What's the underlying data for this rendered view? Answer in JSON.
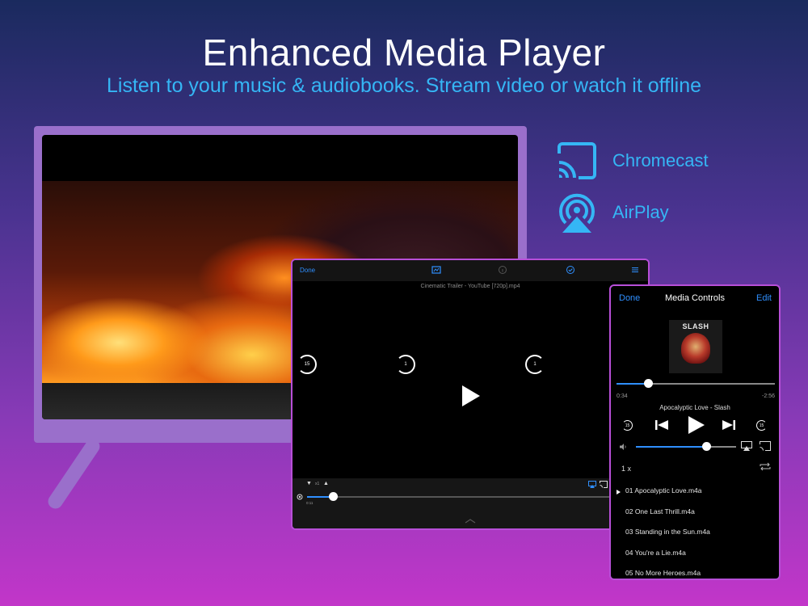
{
  "hero": {
    "title": "Enhanced Media Player",
    "subtitle": "Listen to your music & audiobooks. Stream video or watch it offline"
  },
  "cast": {
    "chromecast_label": "Chromecast",
    "airplay_label": "AirPlay",
    "accent": "#35b6f5"
  },
  "ipad": {
    "done_label": "Done",
    "video_title": "Cinematic Trailer - YouTube [720p].mp4",
    "skip_back_large": "15",
    "skip_back": "1",
    "skip_forward": "1",
    "elapsed": "0:11",
    "progress": 0.08,
    "speed_down": "▼",
    "speed_value": "x1",
    "speed_up": "▲"
  },
  "phone": {
    "done_label": "Done",
    "title": "Media Controls",
    "edit_label": "Edit",
    "album_art_text": "SLASH",
    "elapsed": "0:34",
    "remaining": "-2:56",
    "progress": 0.2,
    "volume": 0.7,
    "track": "Apocalyptic Love - Slash",
    "skip_back": "15",
    "skip_forward": "15",
    "speed": "1 x",
    "playlist": [
      "01 Apocalyptic Love.m4a",
      "02 One Last Thrill.m4a",
      "03 Standing in the Sun.m4a",
      "04 You're a Lie.m4a",
      "05 No More Heroes.m4a"
    ],
    "now_playing_index": 0
  },
  "colors": {
    "link_blue": "#2f8fff",
    "device_border": "#b84fd8",
    "tv_frame": "#9a6fcb"
  }
}
